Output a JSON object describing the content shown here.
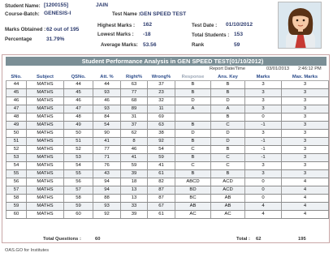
{
  "student": {
    "name_label": "Student Name:",
    "id": "[1200155]",
    "name": "JAIN",
    "batch_label": "Course-Batch:",
    "batch": "GENESIS-I",
    "marks_label": "Marks Obtained :",
    "marks": "62 out of 195",
    "percentage_label": "Percentage",
    "percentage": "31.79%"
  },
  "test": {
    "name_label": "Test Name :",
    "name": "GEN SPEED TEST",
    "highest_label": "Highest Marks :",
    "highest": "162",
    "lowest_label": "Lowest Marks :",
    "lowest": "-18",
    "average_label": "Average Marks:",
    "average": "53.56",
    "date_label": "Test Date :",
    "date": "01/10/2012",
    "total_students_label": "Total Students :",
    "total_students": "153",
    "rank_label": "Rank",
    "rank": "59"
  },
  "report": {
    "title": "Student Performance Analysis in GEN SPEED TEST(01/10/2012)",
    "datetime_label": "Report Date/Time",
    "date": "03/01/2013",
    "time": "2:46:12 PM"
  },
  "table": {
    "headers": [
      "SNo.",
      "Subject",
      "QSNo.",
      "Att. %",
      "Right%",
      "Wrong%",
      "Response",
      "Ans. Key",
      "Marks",
      "Max. Marks"
    ],
    "rows": [
      [
        "44",
        "MATHS",
        "44",
        "44",
        "63",
        "37",
        "B",
        "B",
        "3",
        "3"
      ],
      [
        "45",
        "MATHS",
        "45",
        "93",
        "77",
        "23",
        "B",
        "B",
        "3",
        "3"
      ],
      [
        "46",
        "MATHS",
        "46",
        "46",
        "68",
        "32",
        "D",
        "D",
        "3",
        "3"
      ],
      [
        "47",
        "MATHS",
        "47",
        "93",
        "89",
        "11",
        "A",
        "A",
        "3",
        "3"
      ],
      [
        "48",
        "MATHS",
        "48",
        "84",
        "31",
        "69",
        "",
        "B",
        "0",
        "3"
      ],
      [
        "49",
        "MATHS",
        "49",
        "54",
        "37",
        "63",
        "B",
        "C",
        "-1",
        "3"
      ],
      [
        "50",
        "MATHS",
        "50",
        "90",
        "62",
        "38",
        "D",
        "D",
        "3",
        "3"
      ],
      [
        "51",
        "MATHS",
        "51",
        "41",
        "8",
        "92",
        "B",
        "D",
        "-1",
        "3"
      ],
      [
        "52",
        "MATHS",
        "52",
        "77",
        "46",
        "54",
        "C",
        "B",
        "-1",
        "3"
      ],
      [
        "53",
        "MATHS",
        "53",
        "71",
        "41",
        "59",
        "B",
        "C",
        "-1",
        "3"
      ],
      [
        "54",
        "MATHS",
        "54",
        "76",
        "59",
        "41",
        "C",
        "C",
        "3",
        "3"
      ],
      [
        "55",
        "MATHS",
        "55",
        "43",
        "39",
        "61",
        "B",
        "B",
        "3",
        "3"
      ],
      [
        "56",
        "MATHS",
        "56",
        "94",
        "18",
        "82",
        "ABCD",
        "ACD",
        "0",
        "4"
      ],
      [
        "57",
        "MATHS",
        "57",
        "94",
        "13",
        "87",
        "BD",
        "ACD",
        "0",
        "4"
      ],
      [
        "58",
        "MATHS",
        "58",
        "88",
        "13",
        "87",
        "BC",
        "AB",
        "0",
        "4"
      ],
      [
        "59",
        "MATHS",
        "59",
        "93",
        "33",
        "67",
        "AB",
        "AB",
        "4",
        "4"
      ],
      [
        "60",
        "MATHS",
        "60",
        "92",
        "39",
        "61",
        "AC",
        "AC",
        "4",
        "4"
      ]
    ]
  },
  "totals": {
    "questions_label": "Total Questions :",
    "questions": "60",
    "total_label": "Total :",
    "marks": "62",
    "max_marks": "195"
  },
  "footer": {
    "text": "OAS.GO for Institutes"
  }
}
